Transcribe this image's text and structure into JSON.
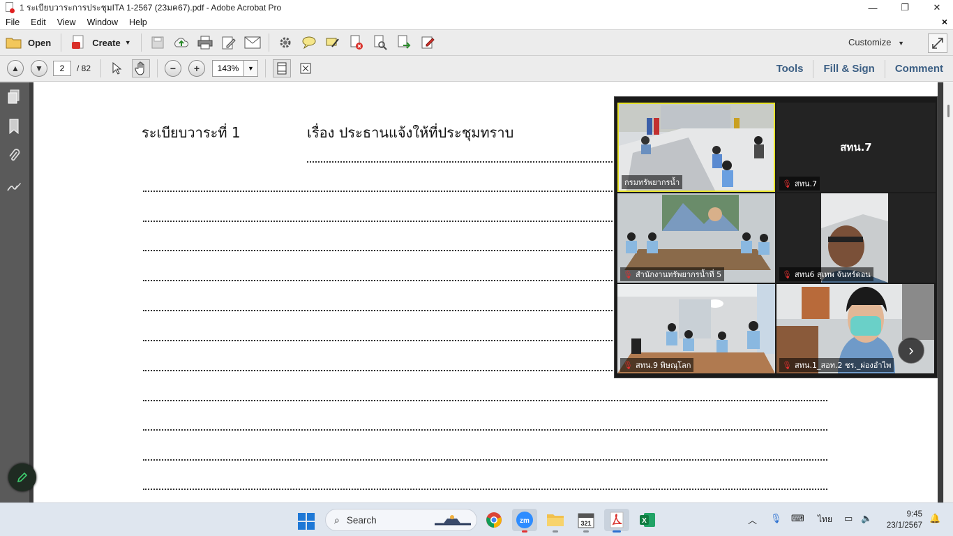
{
  "window": {
    "title": "1 ระเบียบวาระการประชุมITA 1-2567 (23มค67).pdf - Adobe Acrobat Pro",
    "controls": [
      "—",
      "❐",
      "✕"
    ]
  },
  "menu": {
    "items": [
      "File",
      "Edit",
      "View",
      "Window",
      "Help"
    ],
    "close": "×"
  },
  "toolbar": {
    "open_label": "Open",
    "create_label": "Create",
    "customize_label": "Customize"
  },
  "nav": {
    "page_current": "2",
    "page_total": "/ 82",
    "zoom": "143%"
  },
  "right_tabs": {
    "tools": "Tools",
    "fill_sign": "Fill & Sign",
    "comment": "Comment"
  },
  "document": {
    "agenda_label": "ระเบียบวาระที่ 1",
    "agenda_topic": "เรื่อง ประธานแจ้งให้ที่ประชุมทราบ"
  },
  "meeting": {
    "participants": [
      {
        "name": "กรมทรัพยากรน้ำ",
        "muted": false,
        "active": true
      },
      {
        "name": "สทน.7",
        "muted": true,
        "active": false,
        "video_off": true,
        "display_name": "สทน.7"
      },
      {
        "name": "สำนักงานทรัพยากรน้ำที่ 5",
        "muted": true,
        "active": false
      },
      {
        "name": "สทน6 สุเทพ จันทร์ดอน",
        "muted": true,
        "active": false
      },
      {
        "name": "สทน.9 พิษณุโลก",
        "muted": true,
        "active": false
      },
      {
        "name": "สทน.1_สอท.2 ชร._ผ่องอำไพ",
        "muted": true,
        "active": false
      }
    ],
    "next_icon": "chevron-right"
  },
  "taskbar": {
    "search_label": "Search",
    "language": "ไทย",
    "time": "9:45",
    "date": "23/1/2567"
  },
  "colors": {
    "toolbar_bg": "#ececec",
    "tab_text": "#3c5f84",
    "active_tile": "#e6e22a",
    "nav_bg": "#5a5a5a",
    "taskbar_bg": "#dfe6ef"
  }
}
